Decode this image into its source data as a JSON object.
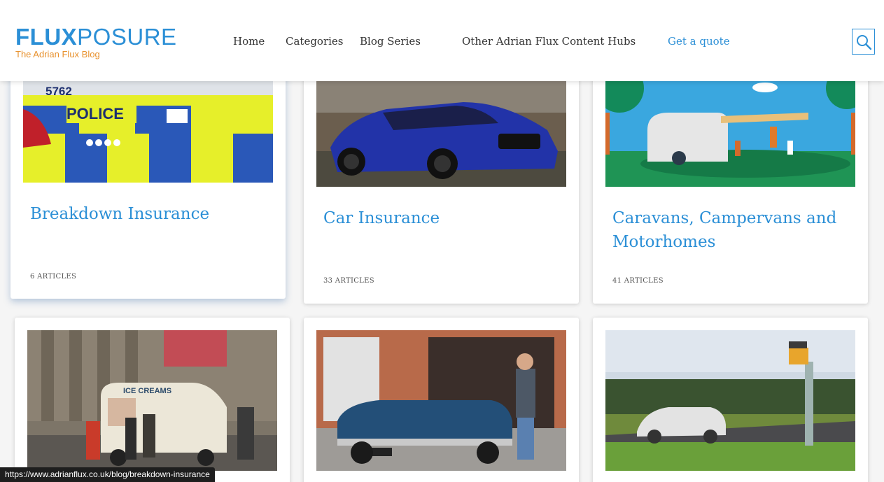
{
  "brand": {
    "logo_bold": "FLUX",
    "logo_light": "POSURE",
    "tagline": "The Adrian Flux Blog",
    "color_primary": "#2b8fd6",
    "color_accent": "#e8912d"
  },
  "nav": {
    "items": [
      {
        "label": "Home"
      },
      {
        "label": "Categories"
      },
      {
        "label": "Blog Series"
      },
      {
        "label": "Other Adrian Flux Content Hubs"
      },
      {
        "label": "Get a quote"
      }
    ],
    "search_icon": "search-icon"
  },
  "cards": [
    {
      "title": "Breakdown Insurance",
      "count": "6 ARTICLES",
      "image": "police-car-photo"
    },
    {
      "title": "Car Insurance",
      "count": "33 ARTICLES",
      "image": "blue-audi-photo"
    },
    {
      "title": "Caravans, Campervans and Motorhomes",
      "count": "41 ARTICLES",
      "image": "campervan-illustration"
    },
    {
      "title": "",
      "count": "",
      "image": "ice-cream-van-photo"
    },
    {
      "title": "",
      "count": "",
      "image": "classic-convertible-photo"
    },
    {
      "title": "",
      "count": "",
      "image": "speed-camera-photo"
    }
  ],
  "status_bar": {
    "url": "https://www.adrianflux.co.uk/blog/breakdown-insurance"
  }
}
